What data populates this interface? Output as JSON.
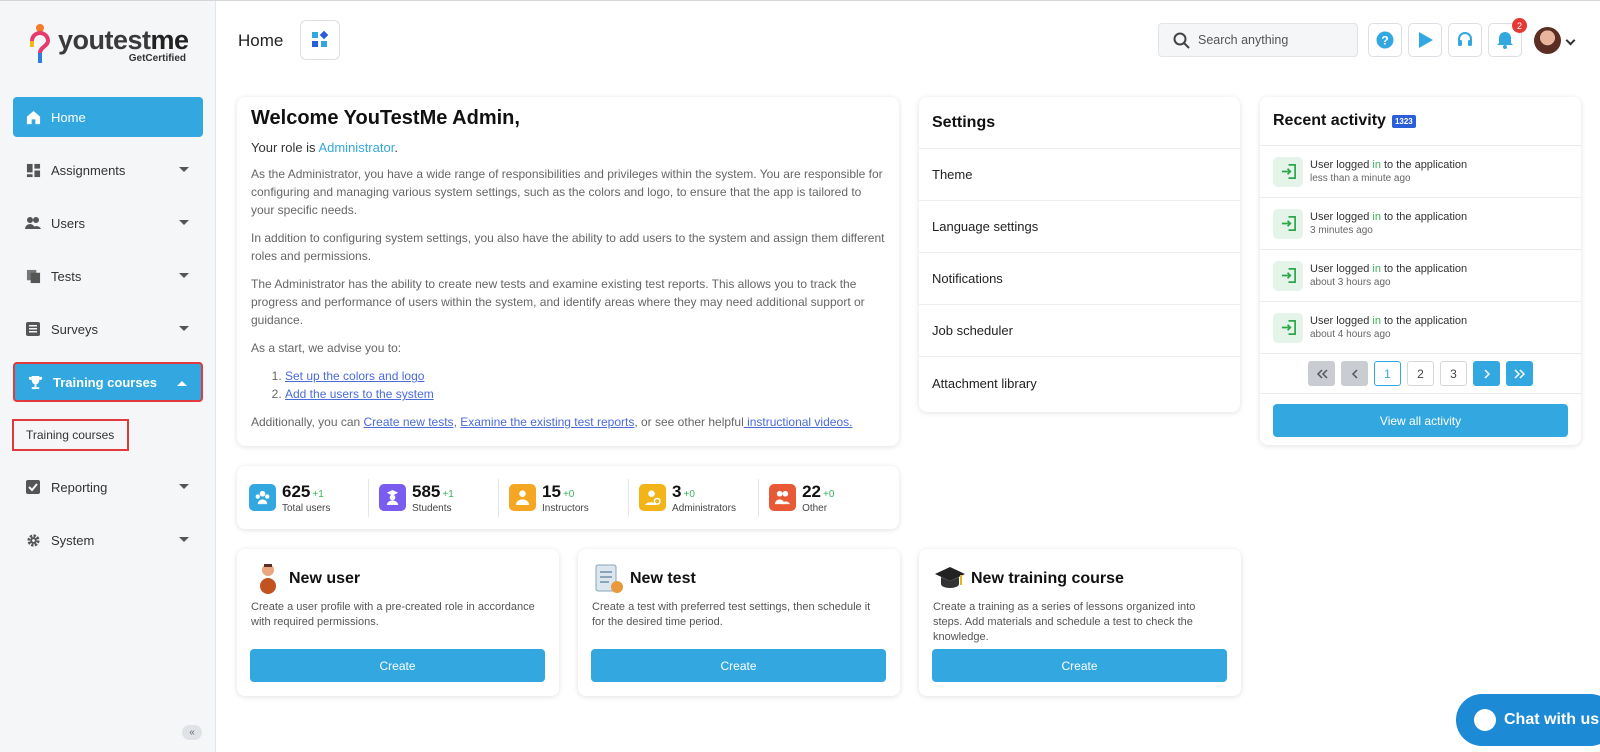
{
  "brand": {
    "name_a": "you",
    "name_b": "test",
    "name_c": "me",
    "tagline": "GetCertified"
  },
  "sidebar": {
    "items": [
      {
        "label": "Home"
      },
      {
        "label": "Assignments"
      },
      {
        "label": "Users"
      },
      {
        "label": "Tests"
      },
      {
        "label": "Surveys"
      },
      {
        "label": "Training courses"
      },
      {
        "label": "Reporting"
      },
      {
        "label": "System"
      }
    ],
    "sub_item": "Training courses",
    "collapse": "«"
  },
  "header": {
    "title": "Home",
    "search_placeholder": "Search anything",
    "notification_count": "2"
  },
  "welcome": {
    "title": "Welcome YouTestMe Admin,",
    "role_prefix": "Your role is ",
    "role": "Administrator",
    "role_suffix": ".",
    "p1": "As the Administrator, you have a wide range of responsibilities and privileges within the system. You are responsible for configuring and managing various system settings, such as the colors and logo, to ensure that the app is tailored to your specific needs.",
    "p2": "In addition to configuring system settings, you also have the ability to add users to the system and assign them different roles and permissions.",
    "p3": "The Administrator has the ability to create new tests and examine existing test reports. This allows you to track the progress and performance of users within the system, and identify areas where they may need additional support or guidance.",
    "p4": "As a start, we advise you to:",
    "steps": [
      "Set up the colors and logo",
      "Add the users to the system"
    ],
    "additional_prefix": "Additionally, you can ",
    "link_new_tests": "Create new tests",
    "sep": ", ",
    "link_reports": "Examine the existing test reports",
    "mid": ", or see other helpful",
    "link_videos": " instructional videos."
  },
  "stats": [
    {
      "value": "625",
      "delta": "+1",
      "label": "Total users",
      "color": "#33a8e0"
    },
    {
      "value": "585",
      "delta": "+1",
      "label": "Students",
      "color": "#7b5cf0"
    },
    {
      "value": "15",
      "delta": "+0",
      "label": "Instructors",
      "color": "#f5a623"
    },
    {
      "value": "3",
      "delta": "+0",
      "label": "Administrators",
      "color": "#f2b416"
    },
    {
      "value": "22",
      "delta": "+0",
      "label": "Other",
      "color": "#e85a35"
    }
  ],
  "quick_actions": [
    {
      "title": "New user",
      "desc": "Create a user profile with a pre-created role in accordance with required permissions.",
      "button": "Create"
    },
    {
      "title": "New test",
      "desc": "Create a test with preferred test settings, then schedule it for the desired time period.",
      "button": "Create"
    },
    {
      "title": "New training course",
      "desc": "Create a training as a series of lessons organized into steps. Add materials and schedule a test to check the knowledge.",
      "button": "Create"
    }
  ],
  "settings": {
    "title": "Settings",
    "items": [
      "Theme",
      "Language settings",
      "Notifications",
      "Job scheduler",
      "Attachment library"
    ]
  },
  "activity": {
    "title": "Recent activity",
    "count": "1323",
    "rows": [
      {
        "pre": "User logged ",
        "in": "in",
        "post": " to the application",
        "time": "less than a minute ago"
      },
      {
        "pre": "User logged ",
        "in": "in",
        "post": " to the application",
        "time": "3 minutes ago"
      },
      {
        "pre": "User logged ",
        "in": "in",
        "post": " to the application",
        "time": "about 3 hours ago"
      },
      {
        "pre": "User logged ",
        "in": "in",
        "post": " to the application",
        "time": "about 4 hours ago"
      }
    ],
    "pages": [
      "1",
      "2",
      "3"
    ],
    "view_all": "View all activity"
  },
  "chat": {
    "label": "Chat with us"
  },
  "colors": {
    "accent": "#33a8e0",
    "highlight": "#e0393e",
    "success": "#3cb35c"
  }
}
